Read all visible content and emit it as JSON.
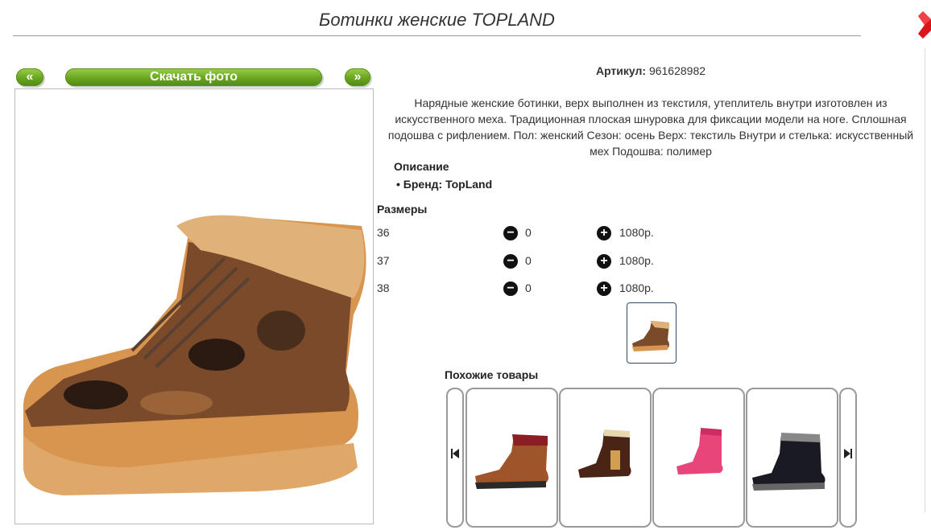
{
  "page": {
    "title": "Ботинки женские TOPLAND"
  },
  "gallery": {
    "prev_label": "«",
    "download_label": "Скачать фото",
    "next_label": "»"
  },
  "product": {
    "article_label": "Артикул:",
    "article_value": "961628982",
    "description": "Нарядные женские ботинки, верх выполнен из текстиля, утеплитель внутри изготовлен из искусственного меха. Традиционная плоская шнуровка для фиксации модели на ноге. Сплошная подошва с рифлением. Пол: женский Сезон: осень Верх: текстиль Внутри и стелька: искусственный мех Подошва: полимер",
    "desc_heading": "Описание",
    "brand_item": "Бренд: TopLand"
  },
  "sizes": {
    "heading": "Размеры",
    "rows": [
      {
        "size": "36",
        "qty": "0",
        "price": "1080р."
      },
      {
        "size": "37",
        "qty": "0",
        "price": "1080р."
      },
      {
        "size": "38",
        "qty": "0",
        "price": "1080р."
      }
    ]
  },
  "similar": {
    "heading": "Похожие товары"
  },
  "colors": {
    "accent_green": "#6aa520",
    "thumb_border": "#334a66",
    "red_mark": "#d9141b"
  },
  "icons": [
    "minus-circle-icon",
    "plus-circle-icon",
    "skip-back-icon",
    "skip-forward-icon",
    "red-arrow-icon"
  ]
}
